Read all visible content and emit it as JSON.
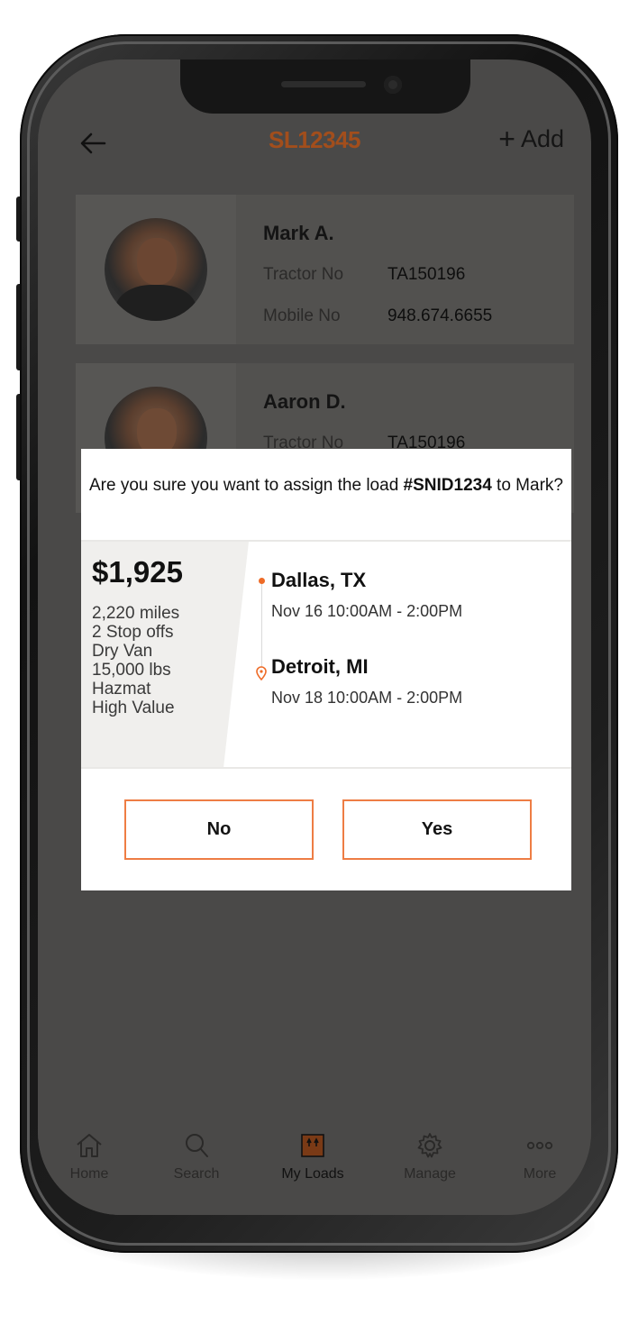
{
  "header": {
    "title": "SL12345",
    "add_label": "Add"
  },
  "drivers": [
    {
      "name": "Mark A.",
      "tractor_label": "Tractor No",
      "tractor_no": "TA150196",
      "mobile_label": "Mobile No",
      "mobile_no": "948.674.6655"
    },
    {
      "name": "Aaron D.",
      "tractor_label": "Tractor No",
      "tractor_no": "TA150196"
    }
  ],
  "modal": {
    "question_prefix": "Are you sure you want to assign the load ",
    "load_id": "#SNID1234",
    "question_suffix": " to Mark?",
    "price": "$1,925",
    "details": [
      "2,220 miles",
      "2 Stop offs",
      "Dry Van",
      "15,000 lbs",
      "Hazmat",
      "High Value"
    ],
    "origin": {
      "city": "Dallas, TX",
      "time": "Nov 16 10:00AM - 2:00PM"
    },
    "destination": {
      "city": "Detroit, MI",
      "time": "Nov 18 10:00AM - 2:00PM"
    },
    "no_label": "No",
    "yes_label": "Yes"
  },
  "nav": {
    "items": [
      {
        "label": "Home",
        "icon": "home-icon"
      },
      {
        "label": "Search",
        "icon": "search-icon"
      },
      {
        "label": "My Loads",
        "icon": "loads-icon"
      },
      {
        "label": "Manage",
        "icon": "gear-icon"
      },
      {
        "label": "More",
        "icon": "more-icon"
      }
    ],
    "active": "My Loads"
  },
  "colors": {
    "accent": "#ee6b27",
    "title": "#a24e1c",
    "overlay": "#4a4948"
  }
}
